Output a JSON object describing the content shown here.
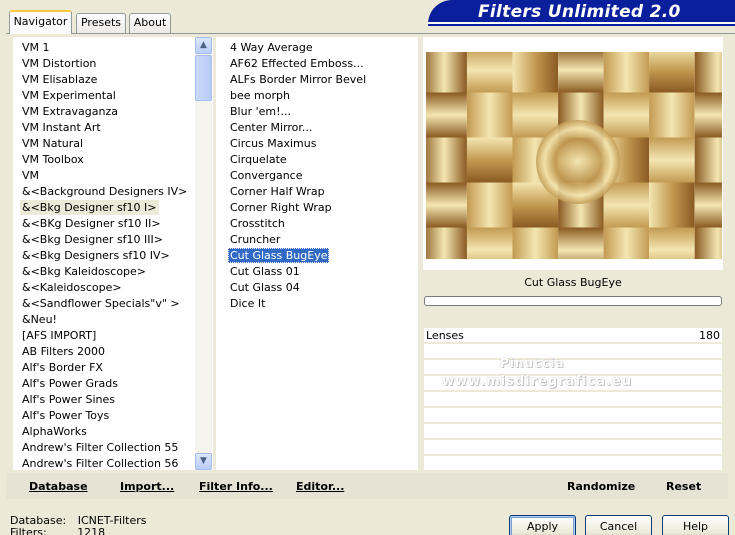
{
  "window": {
    "banner_title": "Filters Unlimited 2.0"
  },
  "tabs": [
    {
      "label": "Navigator",
      "active": true
    },
    {
      "label": "Presets",
      "active": false
    },
    {
      "label": "About",
      "active": false
    }
  ],
  "categories": {
    "items": [
      "VM 1",
      "VM Distortion",
      "VM Elisablaze",
      "VM Experimental",
      "VM Extravaganza",
      "VM Instant Art",
      "VM Natural",
      "VM Toolbox",
      "VM",
      "&<Background Designers IV>",
      "&<Bkg Designer sf10 I>",
      "&<BKg Designer sf10 II>",
      "&<Bkg Designer sf10 III>",
      "&<Bkg Designers sf10 IV>",
      "&<Bkg Kaleidoscope>",
      "&<Kaleidoscope>",
      "&<Sandflower Specials\"v\" >",
      "&Neu!",
      "[AFS IMPORT]",
      "AB Filters 2000",
      "Alf's Border FX",
      "Alf's Power Grads",
      "Alf's Power Sines",
      "Alf's Power Toys",
      "AlphaWorks",
      "Andrew's Filter Collection 55",
      "Andrew's Filter Collection 56"
    ],
    "selected_index": 10
  },
  "filters": {
    "items": [
      "4 Way Average",
      "AF62 Effected Emboss...",
      "ALFs Border Mirror Bevel",
      "bee morph",
      "Blur 'em!...",
      "Center Mirror...",
      "Circus Maximus",
      "Cirquelate",
      "Convergance",
      "Corner Half Wrap",
      "Corner Right Wrap",
      "Crosstitch",
      "Cruncher",
      "Cut Glass  BugEye",
      "Cut Glass 01",
      "Cut Glass 04",
      "Dice It"
    ],
    "selected_index": 13
  },
  "preview": {
    "filter_name": "Cut Glass  BugEye",
    "progress_percent": 0,
    "colors": {
      "dark": "#8a5a22",
      "mid": "#c29a52",
      "light": "#f4e6b0"
    }
  },
  "parameters": [
    {
      "label": "Lenses",
      "value": "180"
    }
  ],
  "watermark": {
    "line1": "Pinuccia",
    "line2": "www.misdiregrafica.eu"
  },
  "bottombar": {
    "database": "Database",
    "import": "Import...",
    "filter_info": "Filter Info...",
    "editor": "Editor...",
    "randomize": "Randomize",
    "reset": "Reset"
  },
  "status": {
    "database_label": "Database:",
    "database_value": "ICNET-Filters",
    "filters_label": "Filters:",
    "filters_value": "1218"
  },
  "buttons": {
    "apply": "Apply",
    "cancel": "Cancel",
    "help": "Help"
  }
}
